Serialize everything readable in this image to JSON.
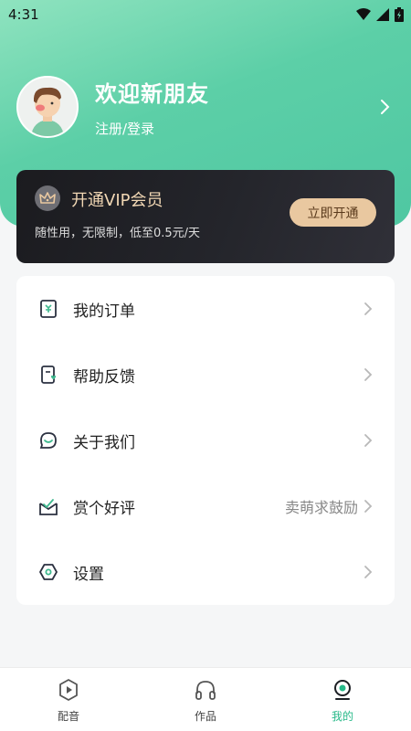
{
  "status_bar": {
    "time": "4:31"
  },
  "profile": {
    "name": "欢迎新朋友",
    "login": "注册/登录"
  },
  "vip": {
    "title": "开通VIP会员",
    "subtitle": "随性用，无限制，低至0.5元/天",
    "button": "立即开通",
    "icon": "crown-icon"
  },
  "menu": {
    "items": [
      {
        "label": "我的订单",
        "icon": "order-icon",
        "extra": ""
      },
      {
        "label": "帮助反馈",
        "icon": "feedback-icon",
        "extra": ""
      },
      {
        "label": "关于我们",
        "icon": "about-icon",
        "extra": ""
      },
      {
        "label": "赏个好评",
        "icon": "rate-icon",
        "extra": "卖萌求鼓励"
      },
      {
        "label": "设置",
        "icon": "settings-icon",
        "extra": ""
      }
    ]
  },
  "tabbar": {
    "tabs": [
      {
        "label": "配音",
        "icon": "dubbing-icon",
        "active": false
      },
      {
        "label": "作品",
        "icon": "headphones-icon",
        "active": false
      },
      {
        "label": "我的",
        "icon": "profile-icon",
        "active": true
      }
    ]
  },
  "colors": {
    "header_gradient_start": "#8fe3bf",
    "header_gradient_end": "#4fc7a2",
    "vip_card": "#1b1b1f",
    "vip_gold": "#e9c8a0",
    "accent_green": "#27b989"
  }
}
